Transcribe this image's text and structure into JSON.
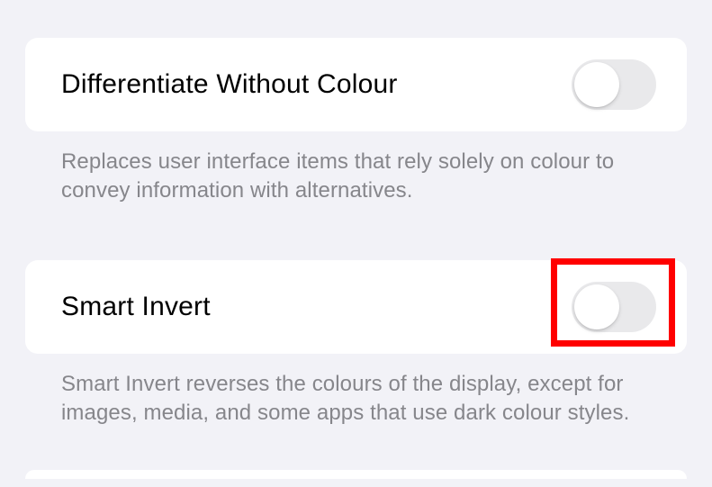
{
  "settings": [
    {
      "label": "Differentiate Without Colour",
      "on": false,
      "description": "Replaces user interface items that rely solely on colour to convey information with alternatives."
    },
    {
      "label": "Smart Invert",
      "on": false,
      "description": "Smart Invert reverses the colours of the display, except for images, media, and some apps that use dark colour styles."
    }
  ],
  "highlight": {
    "target": "smart-invert-toggle"
  }
}
